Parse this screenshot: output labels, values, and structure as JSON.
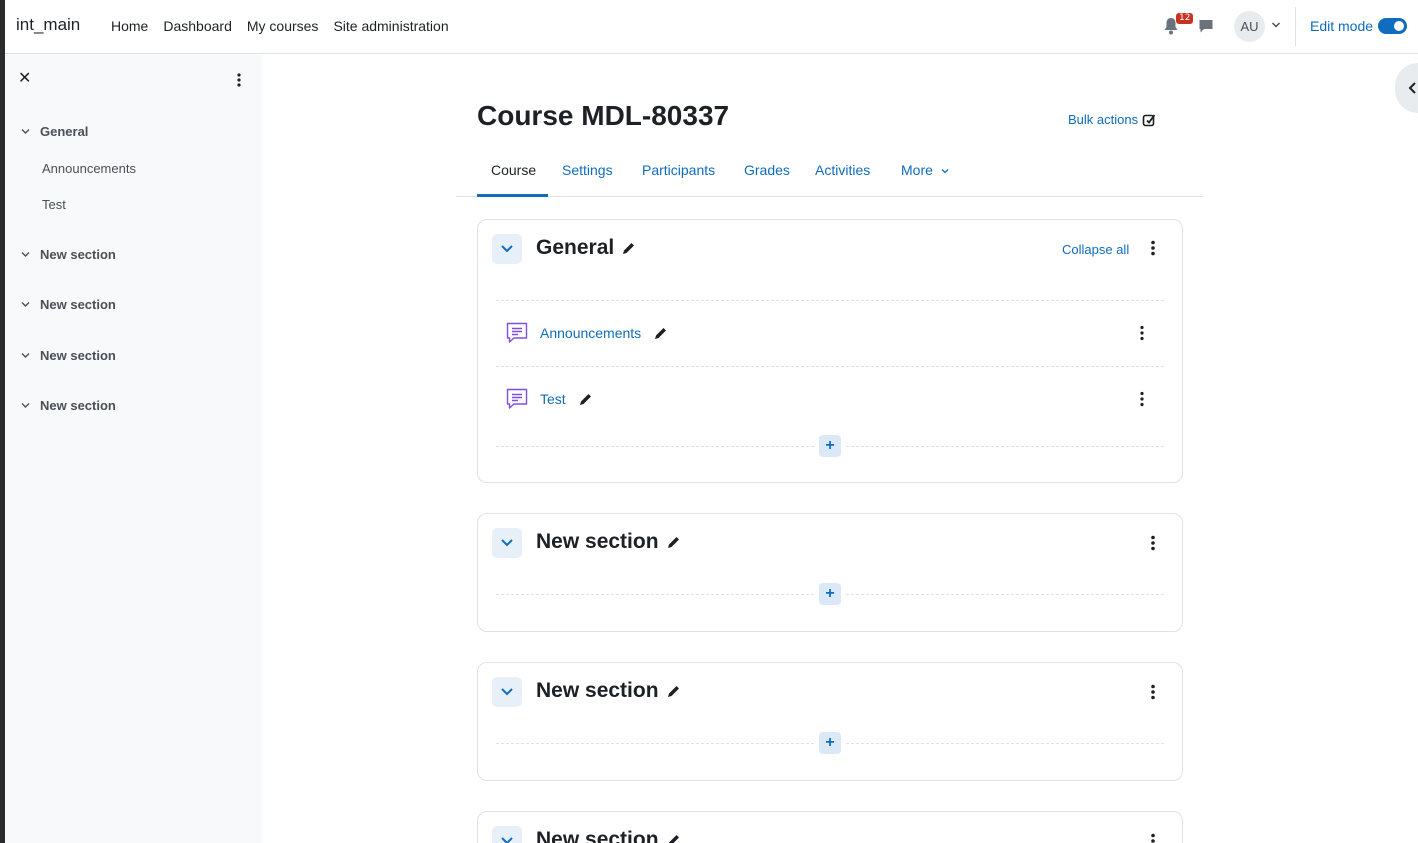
{
  "navbar": {
    "brand": "int_main",
    "links": [
      "Home",
      "Dashboard",
      "My courses",
      "Site administration"
    ],
    "notification_count": "12",
    "avatar_initials": "AU",
    "edit_mode_label": "Edit mode"
  },
  "course_index": {
    "sections": [
      {
        "label": "General",
        "items": [
          "Announcements",
          "Test"
        ]
      },
      {
        "label": "New section"
      },
      {
        "label": "New section"
      },
      {
        "label": "New section"
      },
      {
        "label": "New section"
      }
    ]
  },
  "page": {
    "title": "Course MDL-80337",
    "bulk_actions": "Bulk actions"
  },
  "tabs": [
    "Course",
    "Settings",
    "Participants",
    "Grades",
    "Activities",
    "More"
  ],
  "sections": [
    {
      "title": "General",
      "collapse_all": "Collapse all",
      "activities": [
        "Announcements",
        "Test"
      ]
    },
    {
      "title": "New section"
    },
    {
      "title": "New section"
    },
    {
      "title": "New section"
    }
  ],
  "colors": {
    "accent": "#0f6cbf",
    "forum_icon": "#7e4ee6"
  }
}
